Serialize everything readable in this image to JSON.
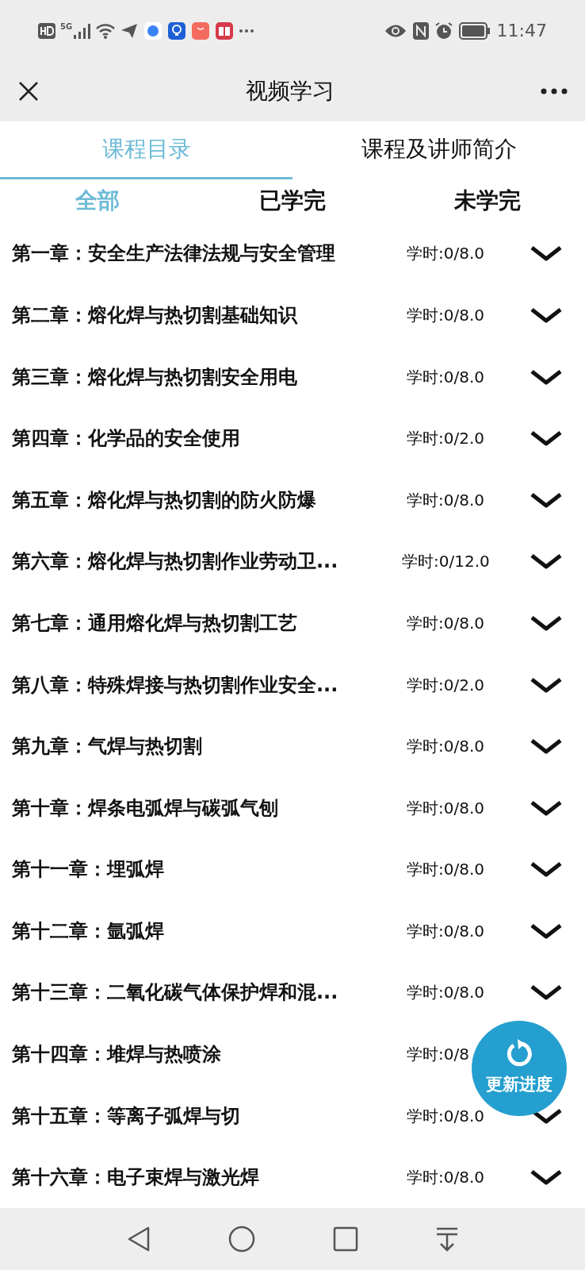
{
  "status_bar": {
    "time": "11:47",
    "network": "5G"
  },
  "header": {
    "title": "视频学习"
  },
  "tabs": [
    {
      "label": "课程目录",
      "selected": true
    },
    {
      "label": "课程及讲师简介",
      "selected": false
    }
  ],
  "filters": [
    {
      "label": "全部",
      "selected": true
    },
    {
      "label": "已学完",
      "selected": false
    },
    {
      "label": "未学完",
      "selected": false
    }
  ],
  "chapters": [
    {
      "title": "第一章：安全生产法律法规与安全管理",
      "hours": "学时:0/8.0"
    },
    {
      "title": "第二章：熔化焊与热切割基础知识",
      "hours": "学时:0/8.0"
    },
    {
      "title": "第三章：熔化焊与热切割安全用电",
      "hours": "学时:0/8.0"
    },
    {
      "title": "第四章：化学品的安全使用",
      "hours": "学时:0/2.0"
    },
    {
      "title": "第五章：熔化焊与热切割的防火防爆",
      "hours": "学时:0/8.0"
    },
    {
      "title": "第六章：熔化焊与热切割作业劳动卫...",
      "hours": "学时:0/12.0"
    },
    {
      "title": "第七章：通用熔化焊与热切割工艺",
      "hours": "学时:0/8.0"
    },
    {
      "title": "第八章：特殊焊接与热切割作业安全...",
      "hours": "学时:0/2.0"
    },
    {
      "title": "第九章：气焊与热切割",
      "hours": "学时:0/8.0"
    },
    {
      "title": "第十章：焊条电弧焊与碳弧气刨",
      "hours": "学时:0/8.0"
    },
    {
      "title": "第十一章：埋弧焊",
      "hours": "学时:0/8.0"
    },
    {
      "title": "第十二章：氩弧焊",
      "hours": "学时:0/8.0"
    },
    {
      "title": "第十三章：二氧化碳气体保护焊和混...",
      "hours": "学时:0/8.0"
    },
    {
      "title": "第十四章：堆焊与热喷涂",
      "hours": "学时:0/8",
      "chevron_shown": false
    },
    {
      "title": "第十五章：等离子弧焊与切",
      "hours": "学时:0/8.0"
    },
    {
      "title": "第十六章：电子束焊与激光焊",
      "hours": "学时:0/8.0"
    }
  ],
  "floating_button": {
    "label": "更新进度"
  }
}
